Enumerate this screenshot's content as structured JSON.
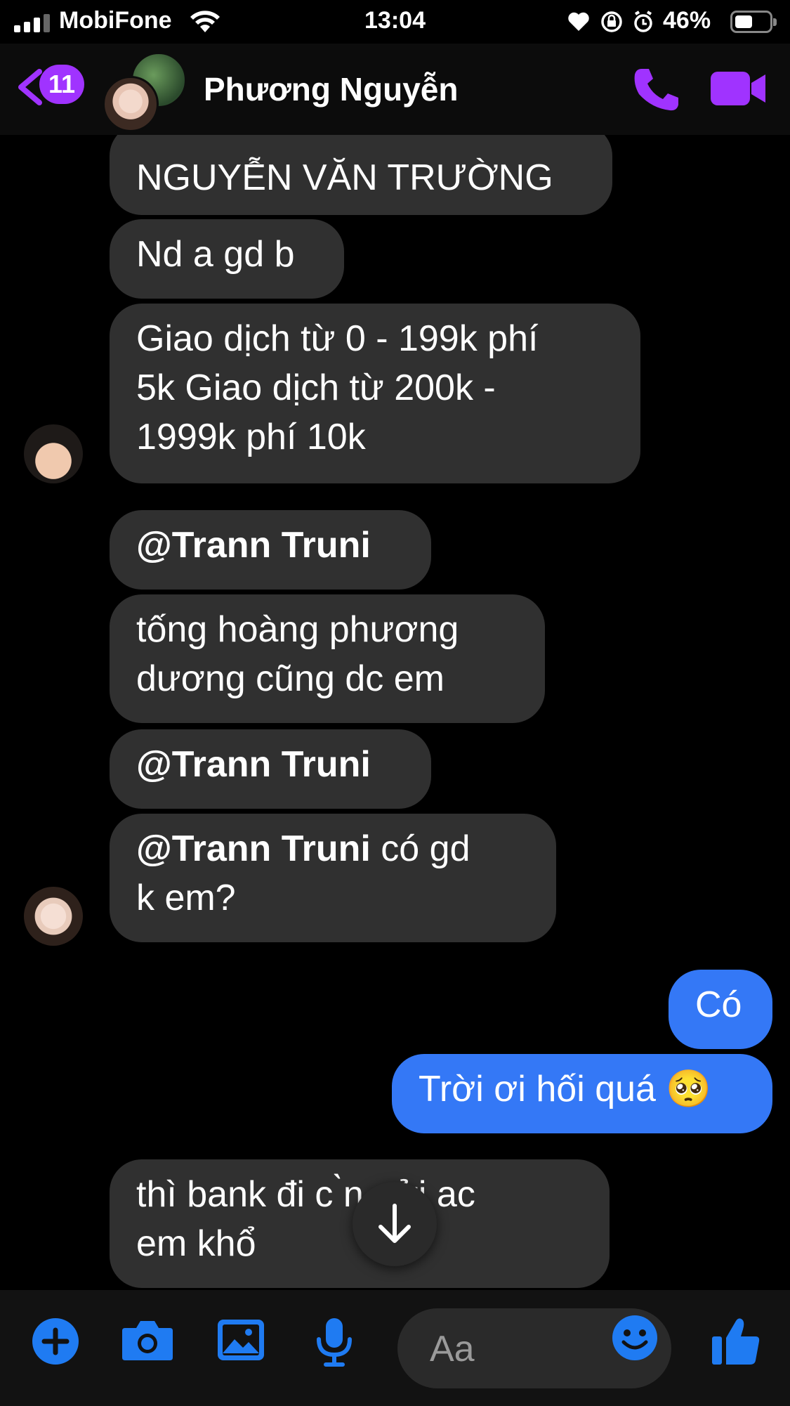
{
  "status_bar": {
    "carrier": "MobiFone",
    "time": "13:04",
    "battery": "46%"
  },
  "header": {
    "back_badge": "11",
    "title": "Phương Nguyễn"
  },
  "messages": [
    {
      "text": "NGUYỄN VĂN TRƯỜNG"
    },
    {
      "text": "Nd a gd b"
    },
    {
      "line1": "Giao dịch từ 0 - 199k phí",
      "line2": "5k  Giao dịch từ 200k -",
      "line3": "1999k phí 10k"
    },
    {
      "mention": "@Trann Truni"
    },
    {
      "line1": "tống hoàng phương",
      "line2": "dương cũng dc em"
    },
    {
      "mention": "@Trann Truni"
    },
    {
      "mention": "@Trann Truni",
      "rest": " có gd",
      "line2": "k em?"
    },
    {
      "text": "Có"
    },
    {
      "text": "Trời ơi hối quá 🥺"
    },
    {
      "line1": "thì bank đi c  ̀n gửi ac",
      "line2": "em khổ"
    }
  ],
  "composer": {
    "placeholder": "Aa"
  },
  "colors": {
    "accent": "#a033ff",
    "my_bubble": "#3478f6",
    "their_bubble": "#303030",
    "composer_icons": "#1f7bf2"
  },
  "icons": [
    "signal-icon",
    "wifi-icon",
    "heart-icon",
    "rotation-lock-icon",
    "alarm-icon",
    "battery-icon",
    "back-chevron-icon",
    "phone-icon",
    "video-camera-icon",
    "arrow-down-icon",
    "plus-icon",
    "camera-icon",
    "image-icon",
    "microphone-icon",
    "emoji-icon",
    "thumbs-up-icon"
  ]
}
